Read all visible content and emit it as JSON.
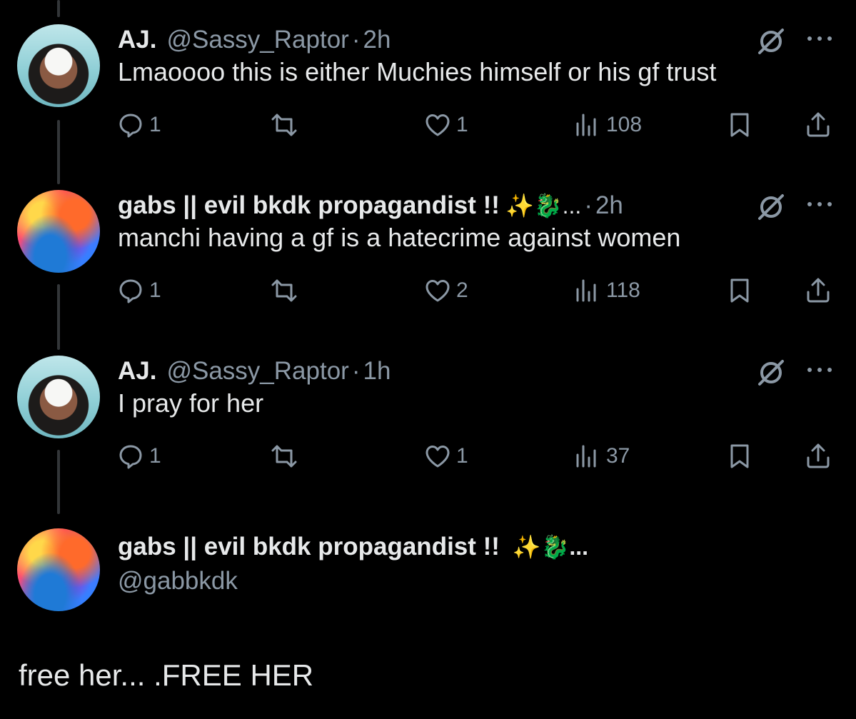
{
  "thread": [
    {
      "display_name": "AJ.",
      "handle": "@Sassy_Raptor",
      "separator": "·",
      "time": "2h",
      "text": "Lmaoooo this is either Muchies himself or his gf trust",
      "emoji": "",
      "avatar": "aj-avatar",
      "stats": {
        "replies": "1",
        "reposts": "",
        "likes": "1",
        "views": "108"
      }
    },
    {
      "display_name": "gabs || evil bkdk propagandist !!",
      "handle": "",
      "separator": "·",
      "time": "2h",
      "text": "manchi having a gf is a hatecrime against women",
      "emoji": "✨🐉...",
      "avatar": "gabs-avatar",
      "stats": {
        "replies": "1",
        "reposts": "",
        "likes": "2",
        "views": "118"
      }
    },
    {
      "display_name": "AJ.",
      "handle": "@Sassy_Raptor",
      "separator": "·",
      "time": "1h",
      "text": "I pray for her",
      "emoji": "",
      "avatar": "aj-avatar",
      "stats": {
        "replies": "1",
        "reposts": "",
        "likes": "1",
        "views": "37"
      }
    }
  ],
  "main_tweet": {
    "display_name": "gabs || evil bkdk propagandist !!",
    "emoji": "✨🐉...",
    "handle": "@gabbkdk",
    "text": "free her... .FREE HER"
  },
  "icons": [
    "reply-icon",
    "repost-icon",
    "like-icon",
    "views-icon",
    "bookmark-icon",
    "share-icon",
    "grok-icon",
    "more-icon"
  ],
  "colors": {
    "background": "#000000",
    "text": "#e7e9ea",
    "muted": "#8b98a5",
    "thread_line": "#333639"
  }
}
